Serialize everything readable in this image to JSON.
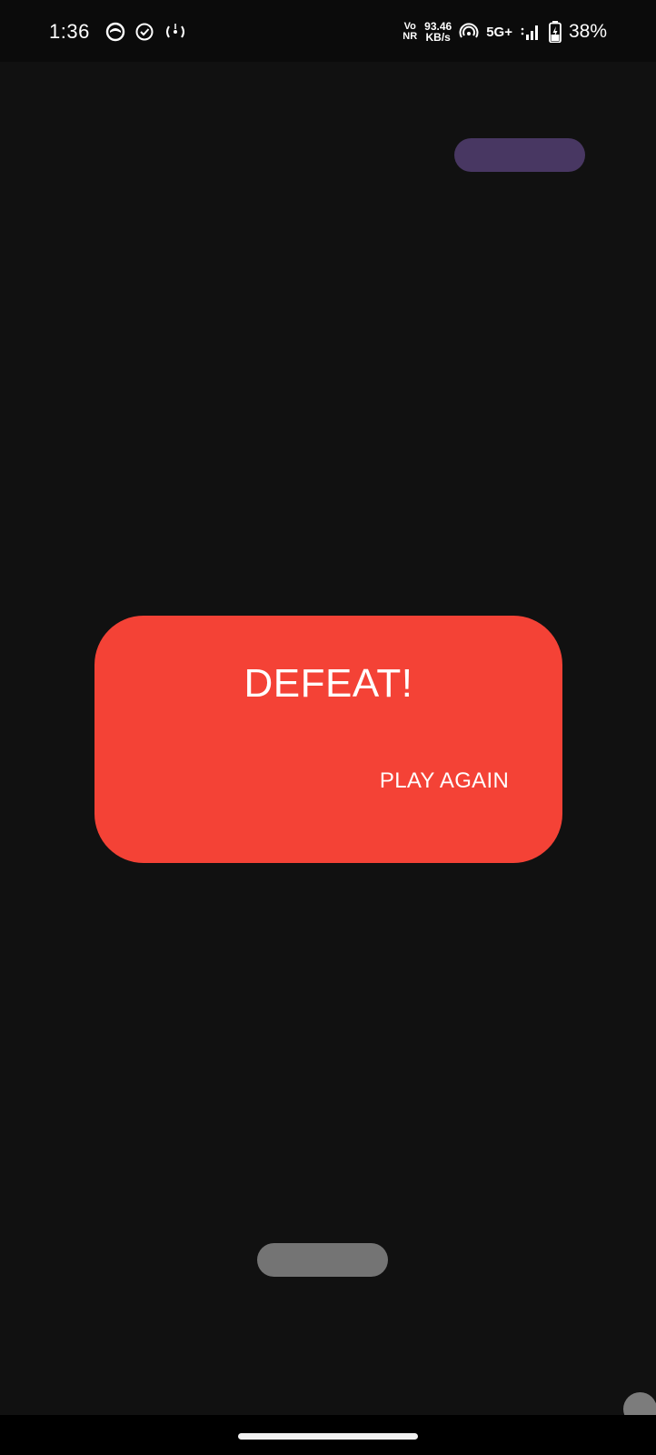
{
  "status_bar": {
    "time": "1:36",
    "volte_top": "Vo",
    "volte_bottom": "NR",
    "speed_value": "93.46",
    "speed_unit": "KB/s",
    "network": "5G+",
    "battery": "38%",
    "icons": [
      "notification-app-icon",
      "check-circle-icon",
      "hotspot-icon",
      "wifi-calling-icon",
      "signal-icon",
      "battery-charging-icon"
    ]
  },
  "dialog": {
    "title": "DEFEAT!",
    "action_label": "PLAY AGAIN"
  },
  "colors": {
    "background": "#111111",
    "dialog": "#f44236",
    "opponent_paddle": "#483762",
    "player_paddle": "#747474",
    "ball": "#7c7c7c"
  }
}
